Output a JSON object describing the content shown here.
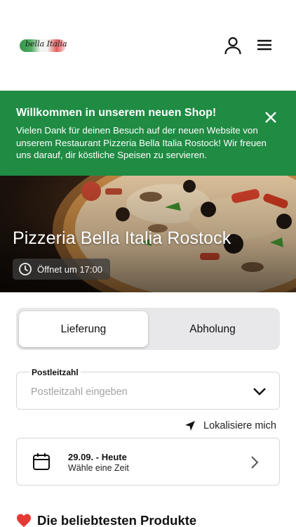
{
  "header": {
    "logo_text": "bella Italia",
    "user_icon": "user-icon",
    "menu_icon": "hamburger-menu-icon"
  },
  "banner": {
    "title": "Willkommen in unserem neuen Shop!",
    "text": "Vielen Dank für deinen Besuch auf der neuen Website von unserem Restaurant Pizzeria Bella Italia Rostock! Wir freuen uns darauf, dir köstliche Speisen zu servieren.",
    "close_icon": "close-icon",
    "color": "#1f8b43"
  },
  "hero": {
    "title": "Pizzeria Bella Italia Rostock",
    "opening": "Öffnet um 17:00",
    "clock_icon": "clock-icon"
  },
  "order_mode": {
    "options": [
      "Lieferung",
      "Abholung"
    ],
    "selected": "Lieferung"
  },
  "zip": {
    "label": "Postleitzahl",
    "placeholder": "Postleitzahl eingeben",
    "value": ""
  },
  "locate": {
    "label": "Lokalisiere mich",
    "icon": "location-arrow-icon"
  },
  "date": {
    "main": "29.09. - Heute",
    "sub": "Wähle eine Zeit",
    "icon": "calendar-icon"
  },
  "popular": {
    "title": "Die beliebtesten Produkte",
    "icon": "heart-icon"
  }
}
